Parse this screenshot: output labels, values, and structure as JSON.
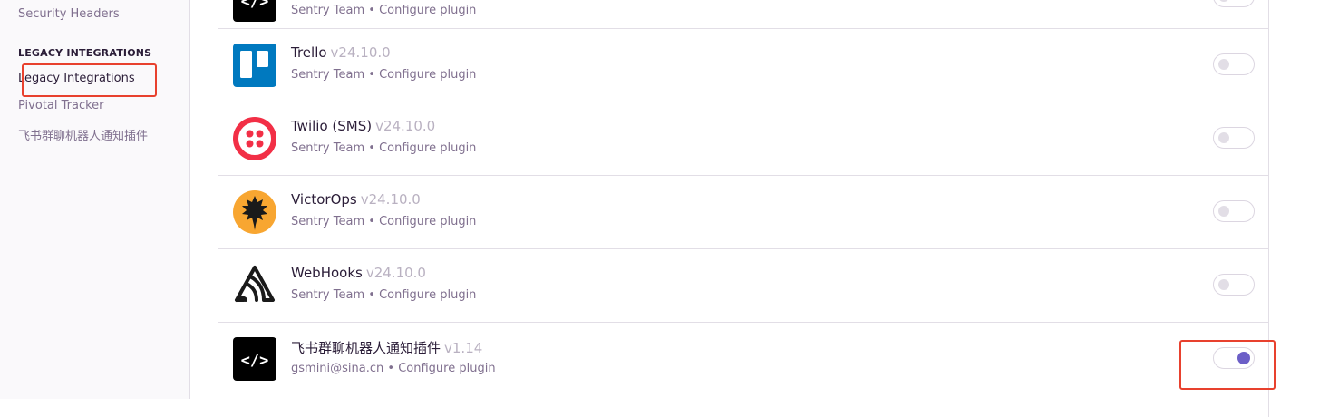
{
  "sidebar": {
    "top_link": "Security Headers",
    "section_heading": "LEGACY INTEGRATIONS",
    "items": [
      {
        "label": "Legacy Integrations"
      },
      {
        "label": "Pivotal Tracker"
      },
      {
        "label": "飞书群聊机器人通知插件"
      }
    ]
  },
  "plugins": [
    {
      "name": "",
      "version": "",
      "author": "Sentry Team",
      "configure": "Configure plugin",
      "enabled": false,
      "icon": "code-icon"
    },
    {
      "name": "Trello",
      "version": "v24.10.0",
      "author": "Sentry Team",
      "configure": "Configure plugin",
      "enabled": false,
      "icon": "trello-icon"
    },
    {
      "name": "Twilio (SMS)",
      "version": "v24.10.0",
      "author": "Sentry Team",
      "configure": "Configure plugin",
      "enabled": false,
      "icon": "twilio-icon"
    },
    {
      "name": "VictorOps",
      "version": "v24.10.0",
      "author": "Sentry Team",
      "configure": "Configure plugin",
      "enabled": false,
      "icon": "victorops-icon"
    },
    {
      "name": "WebHooks",
      "version": "v24.10.0",
      "author": "Sentry Team",
      "configure": "Configure plugin",
      "enabled": false,
      "icon": "sentry-icon"
    },
    {
      "name": "飞书群聊机器人通知插件",
      "version": "v1.14",
      "author": "gsmini@sina.cn",
      "configure": "Configure plugin",
      "enabled": true,
      "icon": "code-icon"
    }
  ],
  "separator": "•",
  "colors": {
    "accent": "#6c5fc7",
    "highlight": "#e8412e",
    "twilio": "#f22f46",
    "trello": "#0079bf",
    "victorops": "#f8a631"
  }
}
